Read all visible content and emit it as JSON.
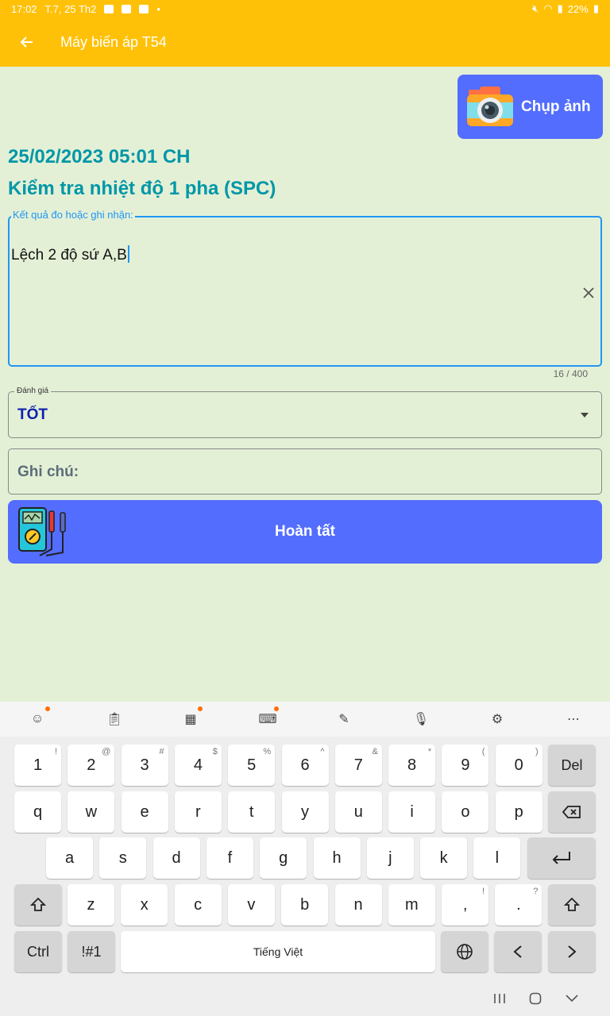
{
  "status_bar": {
    "time": "17:02",
    "date": "T.7, 25 Th2",
    "dot": "•",
    "battery": "22%"
  },
  "app_bar": {
    "title": "Máy biến áp T54"
  },
  "camera_button": {
    "label": "Chụp ảnh"
  },
  "record": {
    "datetime": "25/02/2023 05:01 CH",
    "task_title": "Kiểm tra nhiệt độ 1 pha (SPC)"
  },
  "result_field": {
    "label": "Kết quả đo hoặc ghi nhận:",
    "value": "Lệch 2 độ sứ A,B",
    "counter": "16 / 400"
  },
  "rating_field": {
    "label": "Đánh giá",
    "value": "TỐT"
  },
  "notes_field": {
    "placeholder": "Ghi chú:"
  },
  "complete_button": {
    "label": "Hoàn tất"
  },
  "keyboard": {
    "space_label": "Tiếng Việt",
    "rows": [
      [
        [
          "1",
          "!"
        ],
        [
          "2",
          "@"
        ],
        [
          "3",
          "#"
        ],
        [
          "4",
          "$"
        ],
        [
          "5",
          "%"
        ],
        [
          "6",
          "^"
        ],
        [
          "7",
          "&"
        ],
        [
          "8",
          "*"
        ],
        [
          "9",
          "("
        ],
        [
          "0",
          ")"
        ]
      ],
      [
        [
          "q",
          ""
        ],
        [
          "w",
          ""
        ],
        [
          "e",
          ""
        ],
        [
          "r",
          ""
        ],
        [
          "t",
          ""
        ],
        [
          "y",
          ""
        ],
        [
          "u",
          ""
        ],
        [
          "i",
          ""
        ],
        [
          "o",
          ""
        ],
        [
          "p",
          ""
        ]
      ],
      [
        [
          "a",
          ""
        ],
        [
          "s",
          ""
        ],
        [
          "d",
          ""
        ],
        [
          "f",
          ""
        ],
        [
          "g",
          ""
        ],
        [
          "h",
          ""
        ],
        [
          "j",
          ""
        ],
        [
          "k",
          ""
        ],
        [
          "l",
          ""
        ]
      ],
      [
        [
          "z",
          ""
        ],
        [
          "x",
          ""
        ],
        [
          "c",
          ""
        ],
        [
          "v",
          ""
        ],
        [
          "b",
          ""
        ],
        [
          "n",
          ""
        ],
        [
          "m",
          ""
        ],
        [
          ",",
          "!"
        ],
        [
          ".",
          "?"
        ]
      ]
    ],
    "del_label": "Del",
    "ctrl_label": "Ctrl",
    "sym_label": "!#1"
  },
  "colors": {
    "app_bar": "#ffc107",
    "background": "#e4f0d6",
    "primary_button": "#536dfe",
    "teal_text": "#0097a7",
    "rating_text": "#0d1fae"
  }
}
